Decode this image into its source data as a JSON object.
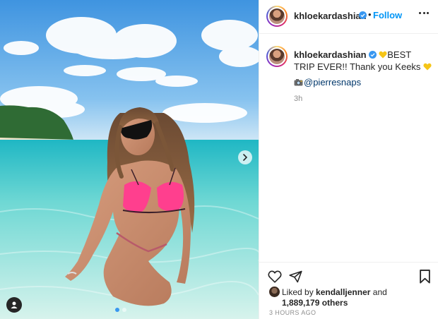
{
  "post": {
    "username": "khloekardashian",
    "follow_label": "Follow",
    "separator": "•",
    "caption_text": "BEST TRIP EVER!! Thank you Keeks",
    "caption_mention": "@pierresnaps",
    "caption_age": "3h",
    "liked_prefix": "Liked by",
    "liked_user": "kendalljenner",
    "liked_and": "and",
    "liked_others": "1,889,179 others",
    "timestamp": "3 HOURS AGO"
  },
  "icons": {
    "verified": "verified-badge-icon",
    "more": "more-options-icon",
    "heart_emoji": "yellow-heart-emoji",
    "camera_emoji": "camera-emoji",
    "like": "heart-outline-icon",
    "share": "paper-plane-icon",
    "save": "bookmark-icon",
    "next": "chevron-right-icon",
    "tag": "user-tag-icon"
  },
  "colors": {
    "link": "#0095f6",
    "mention": "#00376b",
    "muted": "#8e8e8e",
    "text": "#262626",
    "verified": "#3897f0",
    "yellow_heart": "#f5c518"
  },
  "carousel": {
    "slide_count": 2,
    "active_index": 0
  }
}
